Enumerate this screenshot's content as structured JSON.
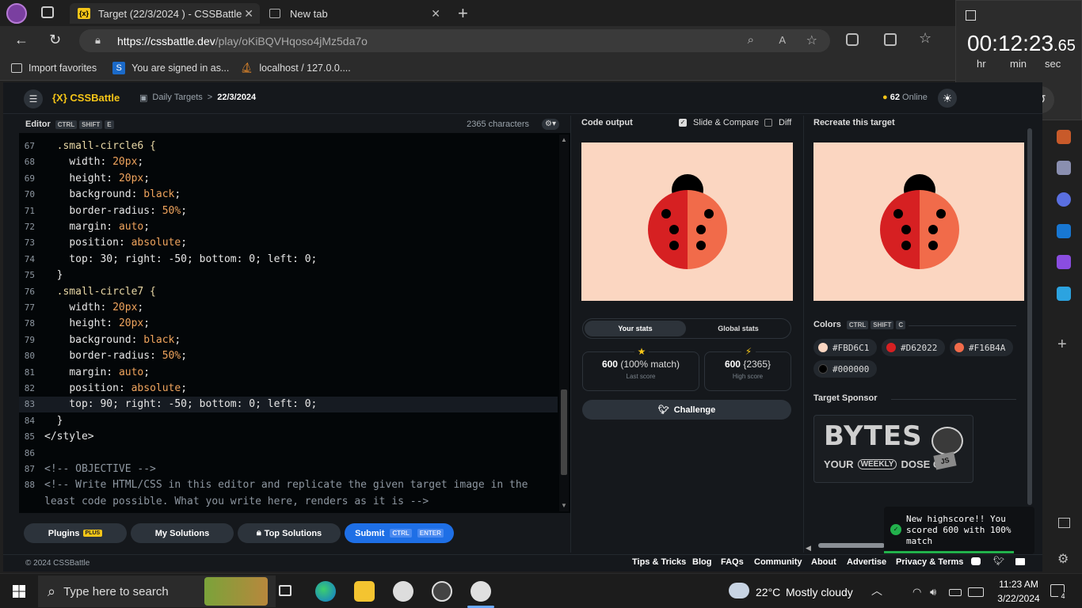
{
  "browser": {
    "tabs": [
      {
        "label": "Target (22/3/2024 ) - CSSBattle",
        "favicon": "{x}"
      },
      {
        "label": "New tab"
      }
    ],
    "url_host": "https://cssbattle.dev",
    "url_path": "/play/oKiBQVHqoso4jMz5da7o",
    "favorites": [
      {
        "label": "Import favorites"
      },
      {
        "label": "You are signed in as..."
      },
      {
        "label": "localhost / 127.0.0...."
      }
    ]
  },
  "timer": {
    "hh": "00",
    "mm": "12",
    "ss": "23",
    "ms": ".65",
    "hr_label": "hr",
    "min_label": "min",
    "sec_label": "sec"
  },
  "header": {
    "logo": "{X} CSSBattle",
    "crumb_daily": "Daily Targets",
    "crumb_sep": ">",
    "crumb_date": "22/3/2024",
    "online_count": "62",
    "online_label": "Online"
  },
  "editor": {
    "title": "Editor",
    "keys": [
      "CTRL",
      "SHIFT",
      "E"
    ],
    "char_count": "2365 characters",
    "lines": [
      {
        "n": "67",
        "text": "  .small-circle6 {",
        "kind": "sel"
      },
      {
        "n": "68",
        "prop": "width",
        "val": "20px"
      },
      {
        "n": "69",
        "prop": "height",
        "val": "20px"
      },
      {
        "n": "70",
        "prop": "background",
        "val": "black"
      },
      {
        "n": "71",
        "prop": "border-radius",
        "val": "50%"
      },
      {
        "n": "72",
        "prop": "margin",
        "val": "auto"
      },
      {
        "n": "73",
        "prop": "position",
        "val": "absolute"
      },
      {
        "n": "74",
        "text": "    top: 30; right: -50; bottom: 0; left: 0;",
        "kind": "prop"
      },
      {
        "n": "75",
        "text": "  }",
        "kind": "prop"
      },
      {
        "n": "76",
        "text": "  .small-circle7 {",
        "kind": "sel"
      },
      {
        "n": "77",
        "prop": "width",
        "val": "20px"
      },
      {
        "n": "78",
        "prop": "height",
        "val": "20px"
      },
      {
        "n": "79",
        "prop": "background",
        "val": "black"
      },
      {
        "n": "80",
        "prop": "border-radius",
        "val": "50%"
      },
      {
        "n": "81",
        "prop": "margin",
        "val": "auto"
      },
      {
        "n": "82",
        "prop": "position",
        "val": "absolute"
      },
      {
        "n": "83",
        "text": "    top: 90; right: -50; bottom: 0; left: 0;",
        "kind": "prop"
      },
      {
        "n": "84",
        "text": "  }",
        "kind": "prop"
      },
      {
        "n": "85",
        "text": "</style>",
        "kind": "prop"
      },
      {
        "n": "86",
        "text": "",
        "kind": "prop"
      },
      {
        "n": "87",
        "text": "<!-- OBJECTIVE -->",
        "kind": "cm"
      },
      {
        "n": "88",
        "text": "<!-- Write HTML/CSS in this editor and replicate the given target image in the",
        "kind": "cm"
      },
      {
        "n": "",
        "text": "least code possible. What you write here, renders as it is -->",
        "kind": "cm"
      }
    ],
    "buttons": {
      "plugins": "Plugins",
      "plugins_badge": "PLUS",
      "my_solutions": "My Solutions",
      "top_solutions": "Top Solutions",
      "submit": "Submit",
      "submit_keys": [
        "CTRL",
        "ENTER"
      ]
    }
  },
  "output": {
    "title": "Code output",
    "slide_compare": "Slide & Compare",
    "diff": "Diff",
    "tabs": [
      "Your stats",
      "Global stats"
    ],
    "last_score_value": "600",
    "last_score_match": "(100% match)",
    "last_score_label": "Last score",
    "high_score_value": "600",
    "high_score_chars": "{2365}",
    "high_score_label": "High score",
    "challenge": "Challenge"
  },
  "target": {
    "title": "Recreate this target",
    "colors_label": "Colors",
    "colors_keys": [
      "CTRL",
      "SHIFT",
      "C"
    ],
    "colors": [
      "#FBD6C1",
      "#D62022",
      "#F16B4A",
      "#000000"
    ],
    "sponsor_label": "Target Sponsor",
    "sponsor_big": "BYTES",
    "sponsor_small_1": "YOUR",
    "sponsor_small_2": "WEEKLY",
    "sponsor_small_3": "DOSE OF",
    "sponsor_js": "JS"
  },
  "toast": {
    "text": "New highscore!! You scored 600 with 100% match"
  },
  "footer": {
    "copyright": "© 2024 CSSBattle",
    "links": [
      "Tips & Tricks",
      "Blog",
      "FAQs",
      "Community",
      "About",
      "Advertise",
      "Privacy & Terms"
    ]
  },
  "taskbar": {
    "search_placeholder": "Type here to search",
    "weather_temp": "22°C",
    "weather_text": "Mostly cloudy",
    "time": "11:23 AM",
    "date": "3/22/2024",
    "notif_count": "4"
  }
}
